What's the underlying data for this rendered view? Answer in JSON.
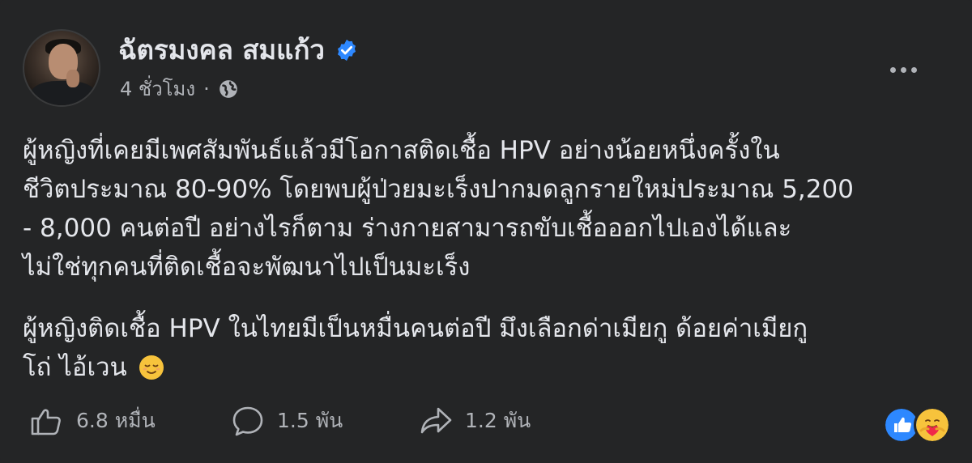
{
  "post": {
    "author": {
      "name": "ฉัตรมงคล สมแก้ว",
      "verified": true,
      "avatar_icon": "profile-photo"
    },
    "meta": {
      "time": "4 ชั่วโมง",
      "separator": "·",
      "audience_icon": "globe-icon"
    },
    "more_icon": "ellipsis-icon",
    "body": {
      "paragraph_1_lines": [
        "ผู้หญิงที่เคยมีเพศสัมพันธ์แล้วมีโอกาสติดเชื้อ HPV อย่างน้อยหนึ่งครั้งใน",
        "ชีวิตประมาณ 80-90% โดยพบผู้ป่วยมะเร็งปากมดลูกรายใหม่ประมาณ 5,200",
        "- 8,000 คนต่อปี อย่างไรก็ตาม ร่างกายสามารถขับเชื้อออกไปเองได้และ",
        "ไม่ใช่ทุกคนที่ติดเชื้อจะพัฒนาไปเป็นมะเร็ง"
      ],
      "paragraph_2_lines": [
        "ผู้หญิงติดเชื้อ HPV ในไทยมีเป็นหมื่นคนต่อปี มึงเลือกด่าเมียกู ด้อยค่าเมียกู",
        "โถ่ ไอ้เวน"
      ],
      "emoji": "relieved-face-emoji"
    },
    "footer": {
      "likes": "6.8 หมื่น",
      "comments": "1.5 พัน",
      "shares": "1.2 พัน",
      "reaction_icons": [
        "like-reaction-icon",
        "care-reaction-icon"
      ]
    },
    "colors": {
      "background": "#242526",
      "text": "#e4e6eb",
      "secondary_text": "#b0b3b8",
      "verified_blue": "#2d88ff"
    }
  }
}
